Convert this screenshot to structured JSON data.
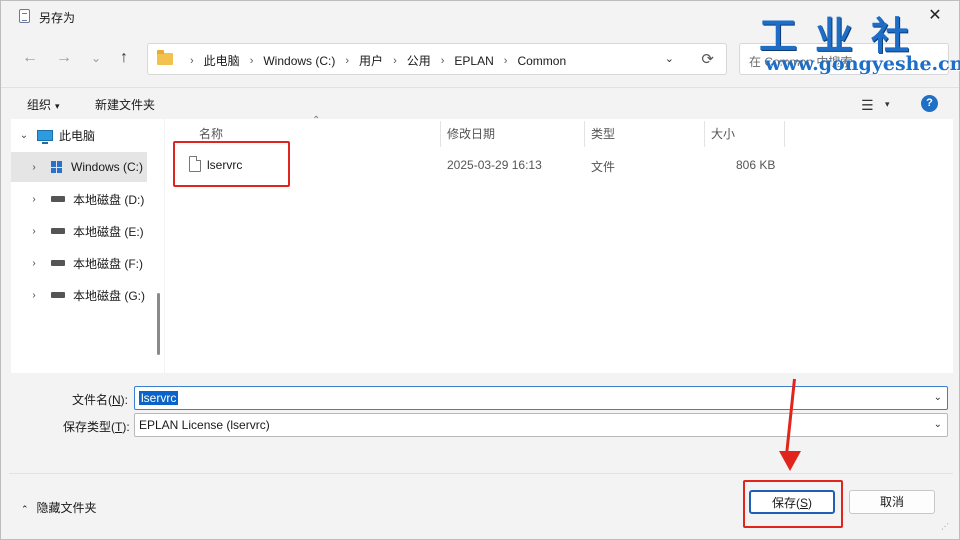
{
  "window": {
    "title": "另存为"
  },
  "nav": {
    "back": "←",
    "forward": "→",
    "recent": "⌄",
    "up": "↑"
  },
  "address": {
    "crumbs": [
      "此电脑",
      "Windows (C:)",
      "用户",
      "公用",
      "EPLAN",
      "Common"
    ],
    "separator": "›",
    "dropdown": "⌄",
    "refresh": "⟳"
  },
  "search": {
    "placeholder": "在 Common 中搜索"
  },
  "watermark": {
    "brand": "工业社",
    "url": "www.gongyeshe.cn"
  },
  "toolbar": {
    "organize_label": "组织",
    "organize_caret": "▾",
    "new_folder_label": "新建文件夹",
    "view_icon": "☰",
    "view_caret": "▾",
    "help_icon": "?"
  },
  "sidebar": {
    "items": [
      {
        "label": "此电脑",
        "icon": "computer-icon",
        "chev": "⌄",
        "selected": false
      },
      {
        "label": "Windows (C:)",
        "icon": "windows-drive-icon",
        "chev": "›",
        "selected": true
      },
      {
        "label": "本地磁盘 (D:)",
        "icon": "drive-icon",
        "chev": "›",
        "selected": false
      },
      {
        "label": "本地磁盘 (E:)",
        "icon": "drive-icon",
        "chev": "›",
        "selected": false
      },
      {
        "label": "本地磁盘 (F:)",
        "icon": "drive-icon",
        "chev": "›",
        "selected": false
      },
      {
        "label": "本地磁盘 (G:)",
        "icon": "drive-icon",
        "chev": "›",
        "selected": false
      }
    ]
  },
  "file_list": {
    "sort_indicator": "⌃",
    "columns": [
      "名称",
      "修改日期",
      "类型",
      "大小"
    ],
    "rows": [
      {
        "name": "lservrc",
        "modified": "2025-03-29 16:13",
        "type": "文件",
        "size": "806 KB"
      }
    ]
  },
  "form": {
    "filename_label": "文件名(",
    "filename_key": "N",
    "filename_tail": "):",
    "filename_value": "lservrc",
    "filetype_label": "保存类型(",
    "filetype_key": "T",
    "filetype_tail": "):",
    "filetype_value": "EPLAN License (lservrc)",
    "dropdown_caret": "⌄"
  },
  "footer": {
    "hide_folders_chev": "⌃",
    "hide_folders_label": "隐藏文件夹",
    "save_label": "保存(",
    "save_key": "S",
    "save_tail": ")",
    "cancel_label": "取消"
  },
  "colors": {
    "accent": "#1f6fc7",
    "annotation": "#e0261c",
    "selection": "#0a64c8"
  }
}
